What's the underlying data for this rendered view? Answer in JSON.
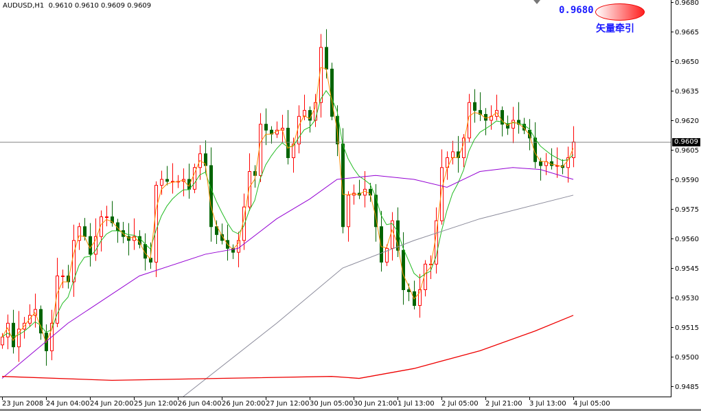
{
  "header": {
    "symbol": "AUDUSD,H1",
    "ohlc": "0.9610 0.9610 0.9609 0.9609"
  },
  "object": {
    "price": "0.9680",
    "label": "矢量牵引"
  },
  "current_price_label": "0.9609",
  "colors": {
    "bull": "#ff0000",
    "bear": "#006400",
    "fast_ma": "#ff8c00",
    "mid_ma": "#22bb22",
    "ma_purple": "#9400d3",
    "ma_gray": "#8a8a9a",
    "ma_red": "#ee0000",
    "price_line": "#808080"
  },
  "chart_data": {
    "type": "candlestick",
    "title": "AUDUSD,H1",
    "ylim": [
      0.9478,
      0.9681
    ],
    "yticks": [
      "0.9680",
      "0.9665",
      "0.9650",
      "0.9635",
      "0.9620",
      "0.9605",
      "0.9590",
      "0.9575",
      "0.9560",
      "0.9545",
      "0.9530",
      "0.9515",
      "0.9500",
      "0.9485"
    ],
    "xticks": [
      "23 Jun 2008",
      "24 Jun 04:00",
      "24 Jun 20:00",
      "25 Jun 12:00",
      "26 Jun 04:00",
      "26 Jun 20:00",
      "27 Jun 12:00",
      "30 Jun 05:00",
      "30 Jun 21:00",
      "1 Jul 13:00",
      "2 Jul 05:00",
      "2 Jul 21:00",
      "3 Jul 13:00",
      "4 Jul 05:00"
    ],
    "close": [
      0.951,
      0.9517,
      0.9505,
      0.9514,
      0.9517,
      0.9521,
      0.9524,
      0.9512,
      0.9503,
      0.9517,
      0.9541,
      0.9541,
      0.9538,
      0.9559,
      0.9566,
      0.9561,
      0.9552,
      0.9561,
      0.9571,
      0.9571,
      0.9568,
      0.9564,
      0.9561,
      0.9559,
      0.9561,
      0.9557,
      0.955,
      0.9548,
      0.9587,
      0.959,
      0.9589,
      0.9589,
      0.9589,
      0.959,
      0.9585,
      0.9596,
      0.9603,
      0.9597,
      0.9566,
      0.9562,
      0.9559,
      0.9555,
      0.9553,
      0.9559,
      0.9576,
      0.9594,
      0.9592,
      0.9618,
      0.9615,
      0.9613,
      0.9615,
      0.9616,
      0.9601,
      0.9608,
      0.9622,
      0.9625,
      0.962,
      0.9629,
      0.9657,
      0.9646,
      0.9622,
      0.9608,
      0.9566,
      0.9582,
      0.9583,
      0.9582,
      0.9585,
      0.9582,
      0.9566,
      0.9548,
      0.9555,
      0.9569,
      0.9554,
      0.9534,
      0.9533,
      0.9526,
      0.9534,
      0.9547,
      0.9547,
      0.9569,
      0.9596,
      0.9601,
      0.9604,
      0.9601,
      0.9611,
      0.9629,
      0.9625,
      0.9623,
      0.962,
      0.9622,
      0.9625,
      0.9618,
      0.9616,
      0.962,
      0.9618,
      0.9615,
      0.9611,
      0.9599,
      0.9597,
      0.9599,
      0.9597,
      0.9597,
      0.9596,
      0.9601,
      0.9609
    ],
    "current_price": 0.9609,
    "ma_lines": [
      {
        "color_key": "ma_purple",
        "points": [
          [
            0,
            0.9489
          ],
          [
            12,
            0.9517
          ],
          [
            25,
            0.9541
          ],
          [
            37,
            0.9552
          ],
          [
            43,
            0.9555
          ],
          [
            50,
            0.957
          ],
          [
            56,
            0.958
          ],
          [
            61,
            0.959
          ],
          [
            68,
            0.9592
          ],
          [
            75,
            0.959
          ],
          [
            81,
            0.9586
          ],
          [
            87,
            0.9594
          ],
          [
            93,
            0.9596
          ],
          [
            98,
            0.9595
          ],
          [
            104,
            0.959
          ]
        ]
      },
      {
        "color_key": "ma_gray",
        "points": [
          [
            33,
            0.9479
          ],
          [
            50,
            0.9517
          ],
          [
            62,
            0.9545
          ],
          [
            75,
            0.9559
          ],
          [
            87,
            0.957
          ],
          [
            104,
            0.9582
          ]
        ]
      },
      {
        "color_key": "ma_red",
        "points": [
          [
            0,
            0.949
          ],
          [
            20,
            0.9488
          ],
          [
            40,
            0.9489
          ],
          [
            60,
            0.949
          ],
          [
            65,
            0.9489
          ],
          [
            75,
            0.9494
          ],
          [
            87,
            0.9503
          ],
          [
            97,
            0.9513
          ],
          [
            104,
            0.9521
          ]
        ]
      }
    ]
  }
}
